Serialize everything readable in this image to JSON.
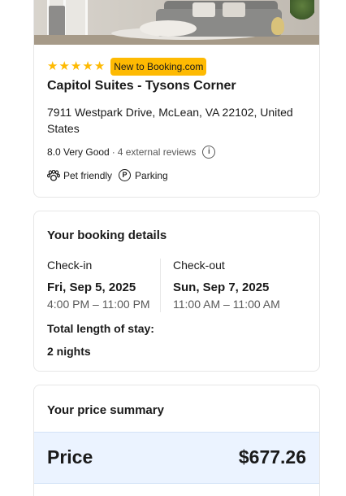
{
  "property": {
    "star_count": 5,
    "badge": "New to Booking.com",
    "name": "Capitol Suites - Tysons Corner",
    "address": "7911 Westpark Drive, McLean, VA 22102, United States",
    "rating_text": "8.0 Very Good",
    "reviews": "4 external reviews",
    "facilities": [
      {
        "label": "Pet friendly",
        "icon": "paw-icon"
      },
      {
        "label": "Parking",
        "icon": "parking-icon"
      }
    ]
  },
  "booking": {
    "title": "Your booking details",
    "checkin": {
      "label": "Check-in",
      "date": "Fri, Sep 5, 2025",
      "time": "4:00 PM – 11:00 PM"
    },
    "checkout": {
      "label": "Check-out",
      "date": "Sun, Sep 7, 2025",
      "time": "11:00 AM – 11:00 AM"
    },
    "stay_label": "Total length of stay:",
    "stay_value": "2 nights"
  },
  "price_summary": {
    "title": "Your price summary",
    "price_label": "Price",
    "price_value": "$677.26"
  },
  "colors": {
    "star": "#feba02",
    "badge_bg": "#feba02",
    "price_band": "#ebf3ff"
  }
}
